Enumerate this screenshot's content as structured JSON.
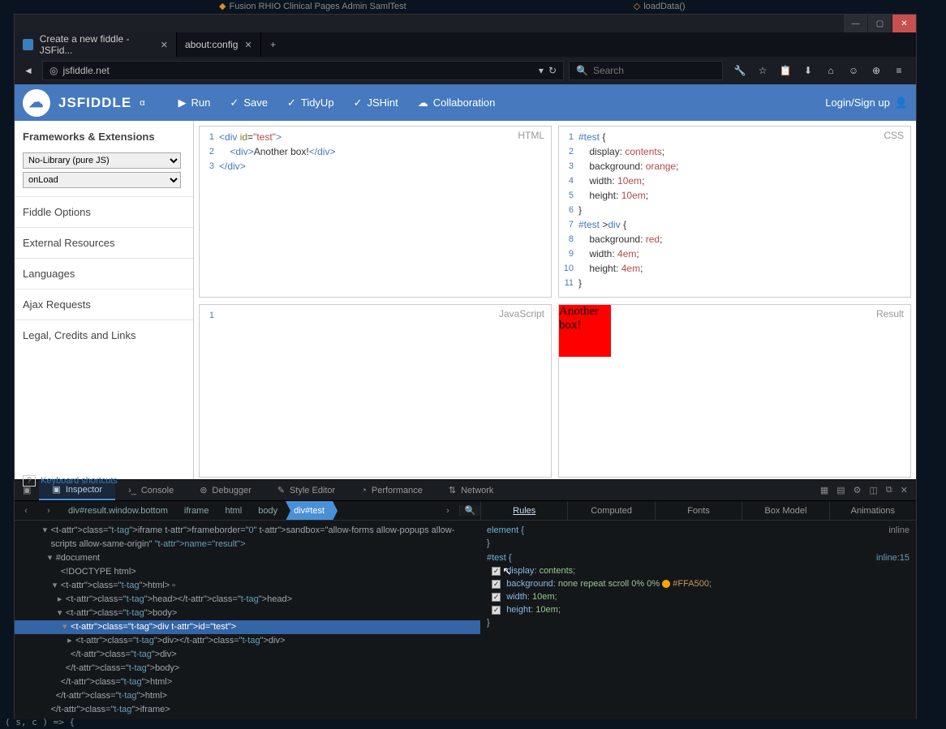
{
  "ide_tabs": [
    {
      "icon": "◆",
      "label": "Fusion RHIO Clinical Pages Admin SamlTest"
    },
    {
      "icon": "◇",
      "label": "loadData()"
    }
  ],
  "window": {
    "controls": {
      "minimize": "—",
      "maximize": "▢",
      "close": "✕"
    }
  },
  "browser_tabs": [
    {
      "label": "Create a new fiddle - JSFid...",
      "active": true
    },
    {
      "label": "about:config",
      "active": false
    }
  ],
  "url": "jsfiddle.net",
  "url_icons": {
    "dropdown": "▾",
    "reload": "↻"
  },
  "search_placeholder": "Search",
  "toolbar_icons": [
    "wrench-icon",
    "star-icon",
    "clipboard-icon",
    "download-icon",
    "home-icon",
    "chat-icon",
    "globe-icon",
    "menu-icon"
  ],
  "toolbar_glyphs": {
    "wrench-icon": "🔧",
    "star-icon": "☆",
    "clipboard-icon": "📋",
    "download-icon": "⬇",
    "home-icon": "⌂",
    "chat-icon": "☺",
    "globe-icon": "⊕",
    "menu-icon": "≡"
  },
  "jsf": {
    "logo": "JSFIDDLE",
    "alpha": "α",
    "actions": [
      {
        "icon": "▶",
        "label": "Run"
      },
      {
        "icon": "✓",
        "label": "Save"
      },
      {
        "icon": "✓",
        "label": "TidyUp"
      },
      {
        "icon": "✓",
        "label": "JSHint"
      },
      {
        "icon": "☁",
        "label": "Collaboration"
      }
    ],
    "login": "Login/Sign up"
  },
  "sidebar": {
    "frameworks_title": "Frameworks & Extensions",
    "library_select": "No-Library (pure JS)",
    "load_select": "onLoad",
    "sections": [
      "Fiddle Options",
      "External Resources",
      "Languages",
      "Ajax Requests",
      "Legal, Credits and Links"
    ],
    "keyboard": "Keyboard shortcuts",
    "qmark": "?"
  },
  "panes": {
    "html_label": "HTML",
    "css_label": "CSS",
    "js_label": "JavaScript",
    "result_label": "Result",
    "html_lines": [
      {
        "n": "1",
        "parts": [
          {
            "t": "<",
            "c": "c-tag"
          },
          {
            "t": "div",
            "c": "c-tag"
          },
          {
            "t": " id",
            "c": "c-attr"
          },
          {
            "t": "=",
            "c": "c-punc"
          },
          {
            "t": "\"test\"",
            "c": "c-str"
          },
          {
            "t": ">",
            "c": "c-tag"
          }
        ]
      },
      {
        "n": "2",
        "indent": "    ",
        "parts": [
          {
            "t": "<",
            "c": "c-tag"
          },
          {
            "t": "div",
            "c": "c-tag"
          },
          {
            "t": ">",
            "c": "c-tag"
          },
          {
            "t": "Another box!",
            "c": "c-punc"
          },
          {
            "t": "</",
            "c": "c-tag"
          },
          {
            "t": "div",
            "c": "c-tag"
          },
          {
            "t": ">",
            "c": "c-tag"
          }
        ]
      },
      {
        "n": "3",
        "parts": [
          {
            "t": "</",
            "c": "c-tag"
          },
          {
            "t": "div",
            "c": "c-tag"
          },
          {
            "t": ">",
            "c": "c-tag"
          }
        ]
      }
    ],
    "css_lines": [
      {
        "n": "1",
        "parts": [
          {
            "t": "#test ",
            "c": "c-sel"
          },
          {
            "t": "{",
            "c": "c-punc"
          }
        ]
      },
      {
        "n": "2",
        "indent": "    ",
        "parts": [
          {
            "t": "display",
            "c": "c-prop"
          },
          {
            "t": ": ",
            "c": "c-punc"
          },
          {
            "t": "contents",
            "c": "c-val"
          },
          {
            "t": ";",
            "c": "c-punc"
          }
        ]
      },
      {
        "n": "3",
        "indent": "    ",
        "parts": [
          {
            "t": "background",
            "c": "c-prop"
          },
          {
            "t": ": ",
            "c": "c-punc"
          },
          {
            "t": "orange",
            "c": "c-val"
          },
          {
            "t": ";",
            "c": "c-punc"
          }
        ]
      },
      {
        "n": "4",
        "indent": "    ",
        "parts": [
          {
            "t": "width",
            "c": "c-prop"
          },
          {
            "t": ": ",
            "c": "c-punc"
          },
          {
            "t": "10em",
            "c": "c-val"
          },
          {
            "t": ";",
            "c": "c-punc"
          }
        ]
      },
      {
        "n": "5",
        "indent": "    ",
        "parts": [
          {
            "t": "height",
            "c": "c-prop"
          },
          {
            "t": ": ",
            "c": "c-punc"
          },
          {
            "t": "10em",
            "c": "c-val"
          },
          {
            "t": ";",
            "c": "c-punc"
          }
        ]
      },
      {
        "n": "6",
        "parts": [
          {
            "t": "}",
            "c": "c-punc"
          }
        ]
      },
      {
        "n": "7",
        "parts": [
          {
            "t": "#test ",
            "c": "c-sel"
          },
          {
            "t": ">",
            "c": "c-punc"
          },
          {
            "t": "div ",
            "c": "c-sel"
          },
          {
            "t": "{",
            "c": "c-punc"
          }
        ]
      },
      {
        "n": "8",
        "indent": "    ",
        "parts": [
          {
            "t": "background",
            "c": "c-prop"
          },
          {
            "t": ": ",
            "c": "c-punc"
          },
          {
            "t": "red",
            "c": "c-val"
          },
          {
            "t": ";",
            "c": "c-punc"
          }
        ]
      },
      {
        "n": "9",
        "indent": "    ",
        "parts": [
          {
            "t": "width",
            "c": "c-prop"
          },
          {
            "t": ": ",
            "c": "c-punc"
          },
          {
            "t": "4em",
            "c": "c-val"
          },
          {
            "t": ";",
            "c": "c-punc"
          }
        ]
      },
      {
        "n": "10",
        "indent": "    ",
        "parts": [
          {
            "t": "height",
            "c": "c-prop"
          },
          {
            "t": ": ",
            "c": "c-punc"
          },
          {
            "t": "4em",
            "c": "c-val"
          },
          {
            "t": ";",
            "c": "c-punc"
          }
        ]
      },
      {
        "n": "11",
        "parts": [
          {
            "t": "}",
            "c": "c-punc"
          }
        ]
      }
    ],
    "js_lines": [
      {
        "n": "1",
        "parts": []
      }
    ],
    "result_text": "Another box!"
  },
  "devtools": {
    "tabs": [
      "Inspector",
      "Console",
      "Debugger",
      "Style Editor",
      "Performance",
      "Network"
    ],
    "tab_icons": {
      "Inspector": "▣",
      "Console": "›_",
      "Debugger": "⊚",
      "Style Editor": "✎",
      "Performance": "◔",
      "Network": "⇅"
    },
    "active_tab": "Inspector",
    "right_icons": [
      "▦",
      "▤",
      "⚙",
      "◫",
      "⧉",
      "✕"
    ],
    "crumb_nav": {
      "left": "‹",
      "right": "›",
      "forward": "›"
    },
    "crumbs": [
      "div#result.window.bottom",
      "iframe",
      "html",
      "body",
      "div#test"
    ],
    "active_crumb": "div#test",
    "search_icon": "🔍",
    "rules_tabs": [
      "Rules",
      "Computed",
      "Fonts",
      "Box Model",
      "Animations"
    ],
    "active_rules_tab": "Rules",
    "dom": [
      {
        "indent": 5,
        "arrow": "▾",
        "html": "<iframe frameborder=\"0\" sandbox=\"allow-forms allow-popups allow-"
      },
      {
        "indent": 5,
        "arrow": "",
        "html": "scripts allow-same-origin\" name=\"result\">"
      },
      {
        "indent": 6,
        "arrow": "▾",
        "html": "#document"
      },
      {
        "indent": 7,
        "arrow": "",
        "html": "<!DOCTYPE html>"
      },
      {
        "indent": 7,
        "arrow": "▾",
        "html": "<html> ▫"
      },
      {
        "indent": 8,
        "arrow": "▸",
        "html": "<head></head>"
      },
      {
        "indent": 8,
        "arrow": "▾",
        "html": "<body>"
      },
      {
        "indent": 9,
        "arrow": "▾",
        "html": "<div id=\"test\">",
        "sel": true
      },
      {
        "indent": 10,
        "arrow": "▸",
        "html": "<div></div>"
      },
      {
        "indent": 9,
        "arrow": "",
        "html": "</div>"
      },
      {
        "indent": 8,
        "arrow": "",
        "html": "</body>"
      },
      {
        "indent": 7,
        "arrow": "",
        "html": "</html>"
      },
      {
        "indent": 6,
        "arrow": "",
        "html": "</html>"
      },
      {
        "indent": 5,
        "arrow": "",
        "html": "</iframe>"
      }
    ],
    "rules": {
      "element_source": "inline",
      "element_sel": "element {",
      "element_close": "}",
      "test_source": "inline:15",
      "test_sel": "#test {",
      "props": [
        {
          "prop": "display",
          "val": "contents",
          "checked": true,
          "cursor": true
        },
        {
          "prop": "background",
          "val": "none repeat scroll 0% 0% ",
          "swatch": "#FFA500",
          "hex": "#FFA500",
          "checked": true
        },
        {
          "prop": "width",
          "val": "10em",
          "checked": true
        },
        {
          "prop": "height",
          "val": "10em",
          "checked": true
        }
      ],
      "test_close": "}"
    }
  },
  "bottom_code": "( s, c ) => {"
}
